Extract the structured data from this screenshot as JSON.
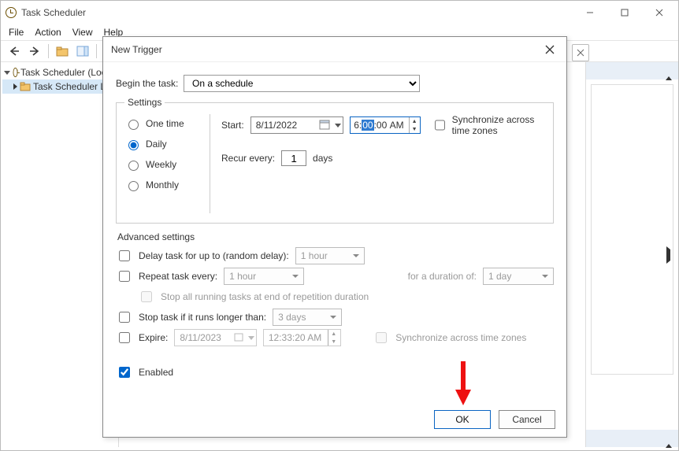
{
  "app": {
    "title": "Task Scheduler"
  },
  "menubar": {
    "file": "File",
    "action": "Action",
    "view": "View",
    "help": "Help"
  },
  "tree": {
    "root": "Task Scheduler (Local)",
    "lib": "Task Scheduler Library"
  },
  "dialog": {
    "title": "New Trigger",
    "begin_label": "Begin the task:",
    "begin_value": "On a schedule",
    "settings_legend": "Settings",
    "radios": {
      "one_time": "One time",
      "daily": "Daily",
      "weekly": "Weekly",
      "monthly": "Monthly",
      "selected": "daily"
    },
    "start_label": "Start:",
    "start_date": "8/11/2022",
    "start_time_h": "6",
    "start_time_m": "00",
    "start_time_s": "00",
    "start_ampm": "AM",
    "sync_tz": "Synchronize across time zones",
    "recur_label": "Recur every:",
    "recur_value": "1",
    "recur_unit": "days",
    "advanced_label": "Advanced settings",
    "delay_label": "Delay task for up to (random delay):",
    "delay_value": "1 hour",
    "repeat_label": "Repeat task every:",
    "repeat_value": "1 hour",
    "duration_label": "for a duration of:",
    "duration_value": "1 day",
    "stop_all_label": "Stop all running tasks at end of repetition duration",
    "stop_if_label": "Stop task if it runs longer than:",
    "stop_if_value": "3 days",
    "expire_label": "Expire:",
    "expire_date": "8/11/2023",
    "expire_time": "12:33:20 AM",
    "sync_tz2": "Synchronize across time zones",
    "enabled_label": "Enabled",
    "ok": "OK",
    "cancel": "Cancel"
  }
}
